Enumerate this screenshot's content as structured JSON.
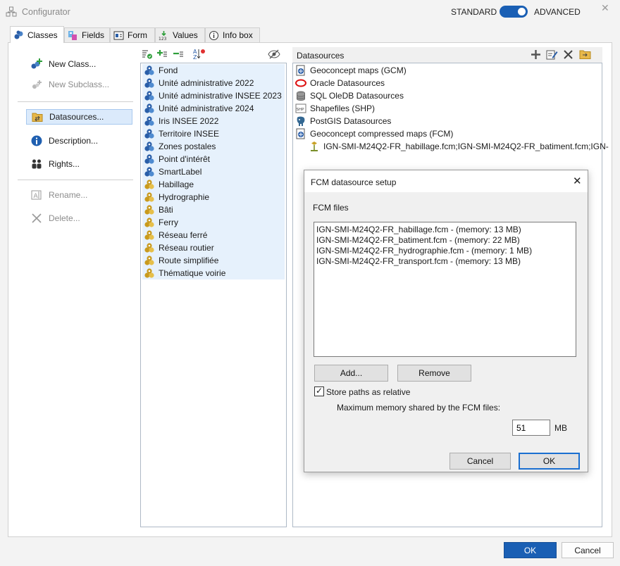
{
  "window": {
    "title": "Configurator",
    "mode_standard": "STANDARD",
    "mode_advanced": "ADVANCED",
    "mode_selected": "ADVANCED",
    "close_glyph": "✕"
  },
  "tabs": [
    {
      "label": "Classes",
      "icon": "classes-icon",
      "active": true
    },
    {
      "label": "Fields",
      "icon": "fields-icon"
    },
    {
      "label": "Form",
      "icon": "form-icon"
    },
    {
      "label": "Values",
      "icon": "values-icon"
    },
    {
      "label": "Info box",
      "icon": "info-icon"
    }
  ],
  "commands": {
    "new_class": "New Class...",
    "new_subclass": "New Subclass...",
    "datasources": "Datasources...",
    "description": "Description...",
    "rights": "Rights...",
    "rename": "Rename...",
    "delete": "Delete..."
  },
  "classes": [
    {
      "label": "Fond",
      "icon": "blue"
    },
    {
      "label": "Unité administrative 2022",
      "icon": "blue"
    },
    {
      "label": "Unité administrative INSEE 2023",
      "icon": "blue"
    },
    {
      "label": "Unité administrative 2024",
      "icon": "blue"
    },
    {
      "label": "Iris INSEE 2022",
      "icon": "blue"
    },
    {
      "label": "Territoire INSEE",
      "icon": "blue"
    },
    {
      "label": "Zones postales",
      "icon": "blue"
    },
    {
      "label": "Point d'intérêt",
      "icon": "blue"
    },
    {
      "label": "SmartLabel",
      "icon": "blue"
    },
    {
      "label": "Habillage",
      "icon": "gold"
    },
    {
      "label": "Hydrographie",
      "icon": "gold"
    },
    {
      "label": "Bâti",
      "icon": "gold"
    },
    {
      "label": "Ferry",
      "icon": "gold"
    },
    {
      "label": "Réseau ferré",
      "icon": "gold"
    },
    {
      "label": "Réseau routier",
      "icon": "gold"
    },
    {
      "label": "Route simplifiée",
      "icon": "gold"
    },
    {
      "label": "Thématique voirie",
      "icon": "gold"
    }
  ],
  "datasources": {
    "title": "Datasources",
    "items": [
      {
        "label": "Geoconcept maps (GCM)",
        "icon": "gcm-icon"
      },
      {
        "label": "Oracle Datasources",
        "icon": "oracle-icon"
      },
      {
        "label": "SQL OleDB Datasources",
        "icon": "database-icon"
      },
      {
        "label": "Shapefiles (SHP)",
        "icon": "shp-icon"
      },
      {
        "label": "PostGIS Datasources",
        "icon": "postgis-icon"
      },
      {
        "label": "Geoconcept compressed maps (FCM)",
        "icon": "gcm-icon"
      }
    ],
    "child": {
      "label": "IGN-SMI-M24Q2-FR_habillage.fcm;IGN-SMI-M24Q2-FR_batiment.fcm;IGN-",
      "icon": "fcm-file-icon"
    }
  },
  "dialog": {
    "title": "FCM datasource setup",
    "files_label": "FCM files",
    "files": [
      "IGN-SMI-M24Q2-FR_habillage.fcm - (memory: 13 MB)",
      "IGN-SMI-M24Q2-FR_batiment.fcm - (memory: 22 MB)",
      "IGN-SMI-M24Q2-FR_hydrographie.fcm - (memory: 1 MB)",
      "IGN-SMI-M24Q2-FR_transport.fcm - (memory: 13 MB)"
    ],
    "add_label": "Add...",
    "remove_label": "Remove",
    "store_relative_label": "Store paths as relative",
    "store_relative_checked": true,
    "memory_label": "Maximum memory shared by the FCM files:",
    "memory_value": "51",
    "memory_unit": "MB",
    "cancel_label": "Cancel",
    "ok_label": "OK"
  },
  "footer": {
    "ok_label": "OK",
    "cancel_label": "Cancel"
  },
  "colors": {
    "accent": "#1a5fb4",
    "selection": "#dbeafb",
    "class_row": "#e6f1fc"
  }
}
